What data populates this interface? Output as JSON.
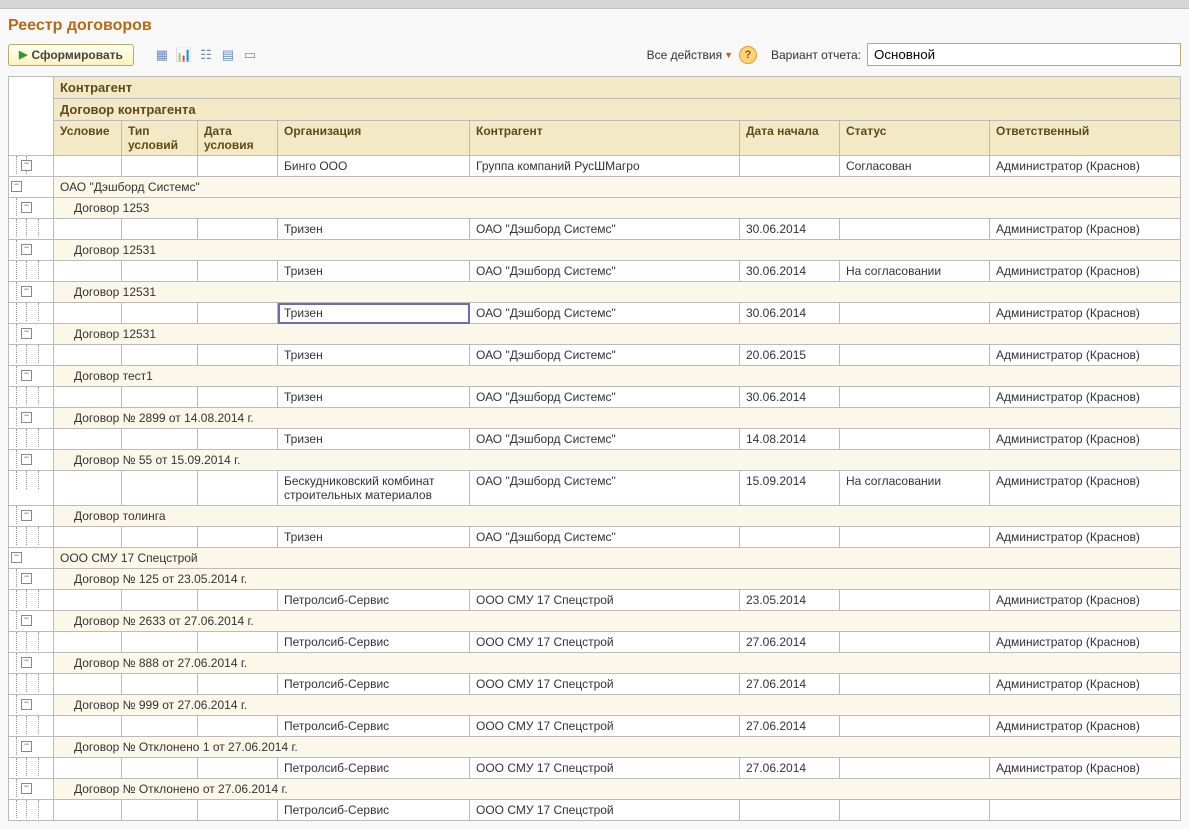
{
  "title": "Реестр договоров",
  "toolbar": {
    "generate": "Сформировать",
    "actions": "Все действия",
    "variant_label": "Вариант отчета:",
    "variant_value": "Основной"
  },
  "headers": {
    "kontragent_top": "Контрагент",
    "dogovor_top": "Договор контрагента",
    "uslovie": "Условие",
    "tip": "Тип условий",
    "data_usl": "Дата условия",
    "org": "Организация",
    "kontr": "Контрагент",
    "start": "Дата начала",
    "status": "Статус",
    "resp": "Ответственный"
  },
  "rows": [
    {
      "kind": "data",
      "exp": "-",
      "level": 1,
      "org": "Бинго ООО",
      "kontr": "Группа компаний РусШМагро",
      "start": "",
      "status": "Согласован",
      "resp": "Администратор (Краснов)",
      "bg": "white"
    },
    {
      "kind": "group",
      "exp": "-",
      "level": 0,
      "label": "ОАО \"Дэшборд Системс\"",
      "span": "top",
      "bg": "alt"
    },
    {
      "kind": "group",
      "exp": "-",
      "level": 1,
      "label": "Договор  1253",
      "span": "sub",
      "bg": "alt"
    },
    {
      "kind": "data",
      "level": 2,
      "org": "Тризен",
      "kontr": "ОАО \"Дэшборд Системс\"",
      "start": "30.06.2014",
      "status": "",
      "resp": "Администратор (Краснов)",
      "bg": "white"
    },
    {
      "kind": "group",
      "exp": "-",
      "level": 1,
      "label": "Договор  12531",
      "span": "sub",
      "bg": "alt"
    },
    {
      "kind": "data",
      "level": 2,
      "org": "Тризен",
      "kontr": "ОАО \"Дэшборд Системс\"",
      "start": "30.06.2014",
      "status": "На согласовании",
      "resp": "Администратор (Краснов)",
      "bg": "white"
    },
    {
      "kind": "group",
      "exp": "-",
      "level": 1,
      "label": "Договор  12531",
      "span": "sub",
      "bg": "alt"
    },
    {
      "kind": "data",
      "level": 2,
      "org": "Тризен",
      "kontr": "ОАО \"Дэшборд Системс\"",
      "start": "30.06.2014",
      "status": "",
      "resp": "Администратор (Краснов)",
      "bg": "white",
      "sel": true
    },
    {
      "kind": "group",
      "exp": "-",
      "level": 1,
      "label": "Договор  12531",
      "span": "sub",
      "bg": "alt"
    },
    {
      "kind": "data",
      "level": 2,
      "org": "Тризен",
      "kontr": "ОАО \"Дэшборд Системс\"",
      "start": "20.06.2015",
      "status": "",
      "resp": "Администратор (Краснов)",
      "bg": "white"
    },
    {
      "kind": "group",
      "exp": "-",
      "level": 1,
      "label": "Договор  тест1",
      "span": "sub",
      "bg": "alt"
    },
    {
      "kind": "data",
      "level": 2,
      "org": "Тризен",
      "kontr": "ОАО \"Дэшборд Системс\"",
      "start": "30.06.2014",
      "status": "",
      "resp": "Администратор (Краснов)",
      "bg": "white"
    },
    {
      "kind": "group",
      "exp": "-",
      "level": 1,
      "label": "Договор № 2899 от 14.08.2014 г.",
      "span": "sub",
      "bg": "alt"
    },
    {
      "kind": "data",
      "level": 2,
      "org": "Тризен",
      "kontr": "ОАО \"Дэшборд Системс\"",
      "start": "14.08.2014",
      "status": "",
      "resp": "Администратор (Краснов)",
      "bg": "white"
    },
    {
      "kind": "group",
      "exp": "-",
      "level": 1,
      "label": "Договор № 55 от 15.09.2014 г.",
      "span": "sub",
      "bg": "alt"
    },
    {
      "kind": "data",
      "level": 2,
      "org": "Бескудниковский комбинат строительных материалов",
      "kontr": "ОАО \"Дэшборд Системс\"",
      "start": "15.09.2014",
      "status": "На согласовании",
      "resp": "Администратор (Краснов)",
      "bg": "white"
    },
    {
      "kind": "group",
      "exp": "-",
      "level": 1,
      "label": "Договор толинга",
      "span": "sub",
      "bg": "alt"
    },
    {
      "kind": "data",
      "level": 2,
      "org": "Тризен",
      "kontr": "ОАО \"Дэшборд Системс\"",
      "start": "",
      "status": "",
      "resp": "Администратор (Краснов)",
      "bg": "white"
    },
    {
      "kind": "group",
      "exp": "-",
      "level": 0,
      "label": "ООО СМУ 17 Спецстрой",
      "span": "top",
      "bg": "alt"
    },
    {
      "kind": "group",
      "exp": "-",
      "level": 1,
      "label": "Договор № 125 от 23.05.2014 г.",
      "span": "sub",
      "bg": "alt"
    },
    {
      "kind": "data",
      "level": 2,
      "org": "Петролсиб-Сервис",
      "kontr": "ООО СМУ 17 Спецстрой",
      "start": "23.05.2014",
      "status": "",
      "resp": "Администратор (Краснов)",
      "bg": "white"
    },
    {
      "kind": "group",
      "exp": "-",
      "level": 1,
      "label": "Договор № 2633 от 27.06.2014 г.",
      "span": "sub",
      "bg": "alt"
    },
    {
      "kind": "data",
      "level": 2,
      "org": "Петролсиб-Сервис",
      "kontr": "ООО СМУ 17 Спецстрой",
      "start": "27.06.2014",
      "status": "",
      "resp": "Администратор (Краснов)",
      "bg": "white"
    },
    {
      "kind": "group",
      "exp": "-",
      "level": 1,
      "label": "Договор № 888 от 27.06.2014 г.",
      "span": "sub",
      "bg": "alt"
    },
    {
      "kind": "data",
      "level": 2,
      "org": "Петролсиб-Сервис",
      "kontr": "ООО СМУ 17 Спецстрой",
      "start": "27.06.2014",
      "status": "",
      "resp": "Администратор (Краснов)",
      "bg": "white"
    },
    {
      "kind": "group",
      "exp": "-",
      "level": 1,
      "label": "Договор № 999 от 27.06.2014 г.",
      "span": "sub",
      "bg": "alt"
    },
    {
      "kind": "data",
      "level": 2,
      "org": "Петролсиб-Сервис",
      "kontr": "ООО СМУ 17 Спецстрой",
      "start": "27.06.2014",
      "status": "",
      "resp": "Администратор (Краснов)",
      "bg": "white"
    },
    {
      "kind": "group",
      "exp": "-",
      "level": 1,
      "label": "Договор № Отклонено 1 от 27.06.2014 г.",
      "span": "sub",
      "bg": "alt"
    },
    {
      "kind": "data",
      "level": 2,
      "org": "Петролсиб-Сервис",
      "kontr": "ООО СМУ 17 Спецстрой",
      "start": "27.06.2014",
      "status": "",
      "resp": "Администратор (Краснов)",
      "bg": "white"
    },
    {
      "kind": "group",
      "exp": "-",
      "level": 1,
      "label": "Договор № Отклонено от 27.06.2014 г.",
      "span": "sub",
      "bg": "alt"
    },
    {
      "kind": "data",
      "level": 2,
      "org": "Петролсиб-Сервис",
      "kontr": "ООО СМУ 17 Спецстрой",
      "start": "",
      "status": "",
      "resp": "",
      "bg": "white"
    }
  ]
}
